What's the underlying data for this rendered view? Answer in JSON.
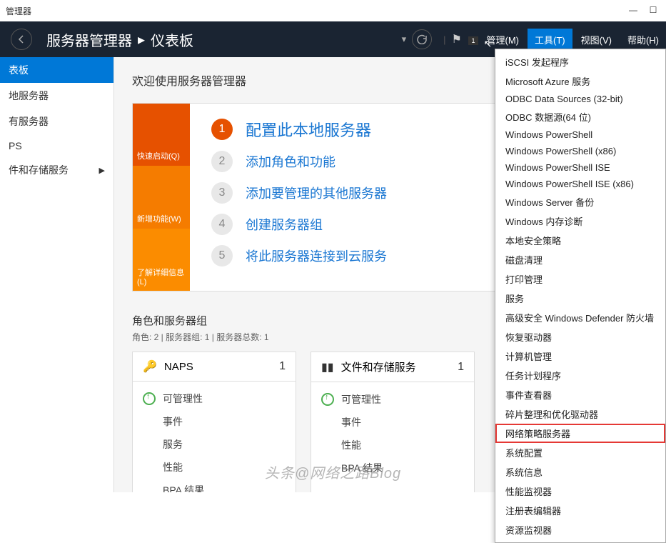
{
  "titlebar": {
    "title": "管理器"
  },
  "header": {
    "title": "服务器管理器",
    "separator": "•",
    "subtitle": "仪表板",
    "menus": {
      "manage": "管理(M)",
      "tools": "工具(T)",
      "view": "视图(V)",
      "help": "帮助(H)"
    },
    "notif": "1"
  },
  "sidebar": {
    "items": [
      {
        "label": "表板"
      },
      {
        "label": "地服务器"
      },
      {
        "label": "有服务器"
      },
      {
        "label": "PS"
      },
      {
        "label": "件和存储服务"
      }
    ]
  },
  "main": {
    "welcome": "欢迎使用服务器管理器",
    "quick_tiles": {
      "quick_start": "快速启动(Q)",
      "whats_new": "新增功能(W)",
      "learn_more": "了解详细信息(L)"
    },
    "steps": [
      {
        "num": "1",
        "text": "配置此本地服务器"
      },
      {
        "num": "2",
        "text": "添加角色和功能"
      },
      {
        "num": "3",
        "text": "添加要管理的其他服务器"
      },
      {
        "num": "4",
        "text": "创建服务器组"
      },
      {
        "num": "5",
        "text": "将此服务器连接到云服务"
      }
    ],
    "groups": {
      "title": "角色和服务器组",
      "subtitle": "角色: 2 | 服务器组: 1 | 服务器总数: 1",
      "tiles": [
        {
          "title": "NAPS",
          "count": "1",
          "rows": [
            "可管理性",
            "事件",
            "服务",
            "性能",
            "BPA 结果"
          ]
        },
        {
          "title": "文件和存储服务",
          "count": "1",
          "rows": [
            "可管理性",
            "事件",
            "性能",
            "BPA 结果"
          ]
        }
      ]
    }
  },
  "tools_menu": [
    "iSCSI 发起程序",
    "Microsoft Azure 服务",
    "ODBC Data Sources (32-bit)",
    "ODBC 数据源(64 位)",
    "Windows PowerShell",
    "Windows PowerShell (x86)",
    "Windows PowerShell ISE",
    "Windows PowerShell ISE (x86)",
    "Windows Server 备份",
    "Windows 内存诊断",
    "本地安全策略",
    "磁盘清理",
    "打印管理",
    "服务",
    "高级安全 Windows Defender 防火墙",
    "恢复驱动器",
    "计算机管理",
    "任务计划程序",
    "事件查看器",
    "碎片整理和优化驱动器",
    "网络策略服务器",
    "系统配置",
    "系统信息",
    "性能监视器",
    "注册表编辑器",
    "资源监视器"
  ],
  "watermark": "头条@网络之路Blog"
}
